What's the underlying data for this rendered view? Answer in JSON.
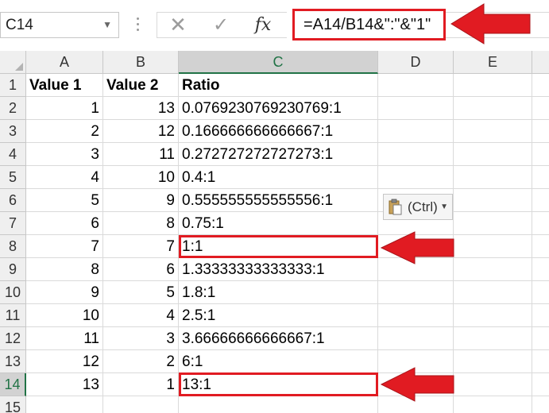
{
  "formula_bar": {
    "name_box": "C14",
    "cancel_glyph": "✕",
    "enter_glyph": "✓",
    "fx_label": "fx",
    "formula": "=A14/B14&\":\"&\"1\""
  },
  "column_headers": [
    "A",
    "B",
    "C",
    "D",
    "E"
  ],
  "row_headers": [
    "1",
    "2",
    "3",
    "4",
    "5",
    "6",
    "7",
    "8",
    "9",
    "10",
    "11",
    "12",
    "13",
    "14",
    "15"
  ],
  "header_row": {
    "a": "Value 1",
    "b": "Value 2",
    "c": "Ratio"
  },
  "rows": [
    {
      "a": "1",
      "b": "13",
      "c": "0.0769230769230769:1"
    },
    {
      "a": "2",
      "b": "12",
      "c": "0.166666666666667:1"
    },
    {
      "a": "3",
      "b": "11",
      "c": "0.272727272727273:1"
    },
    {
      "a": "4",
      "b": "10",
      "c": "0.4:1"
    },
    {
      "a": "5",
      "b": "9",
      "c": "0.555555555555556:1"
    },
    {
      "a": "6",
      "b": "8",
      "c": "0.75:1"
    },
    {
      "a": "7",
      "b": "7",
      "c": "1:1"
    },
    {
      "a": "8",
      "b": "6",
      "c": "1.33333333333333:1"
    },
    {
      "a": "9",
      "b": "5",
      "c": "1.8:1"
    },
    {
      "a": "10",
      "b": "4",
      "c": "2.5:1"
    },
    {
      "a": "11",
      "b": "3",
      "c": "3.66666666666667:1"
    },
    {
      "a": "12",
      "b": "2",
      "c": "6:1"
    },
    {
      "a": "13",
      "b": "1",
      "c": "13:1"
    }
  ],
  "paste_options": {
    "label": "(Ctrl)"
  },
  "colors": {
    "highlight": "#e11b22",
    "excel_green": "#217346"
  },
  "icons": [
    "chevron-down-icon",
    "cancel-icon",
    "check-icon",
    "fx-icon",
    "clipboard-icon",
    "arrow-left-icon"
  ]
}
